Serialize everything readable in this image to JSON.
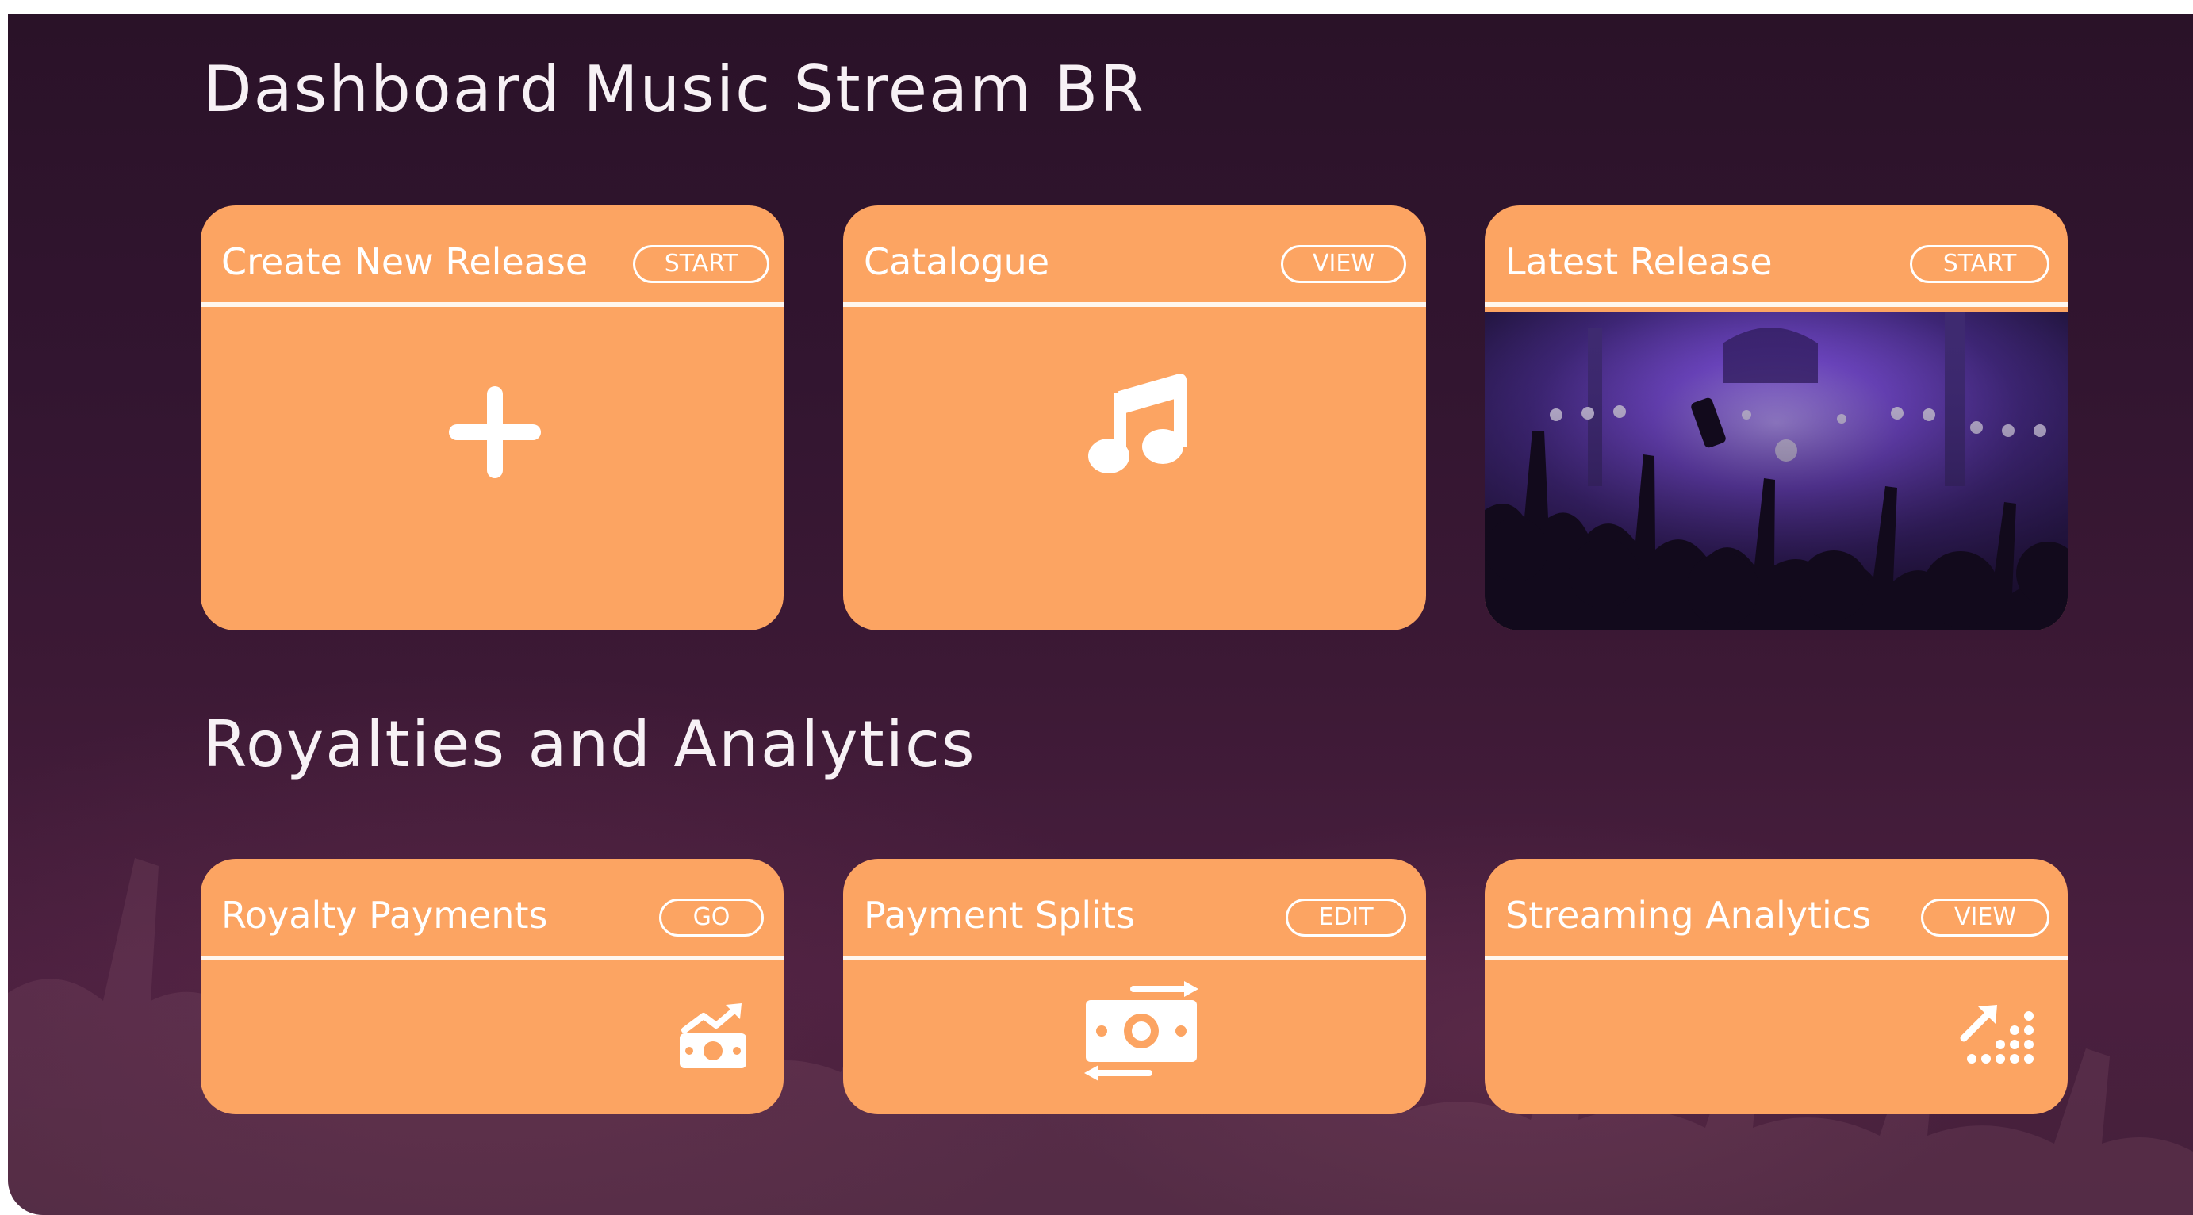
{
  "sections": {
    "dashboard": {
      "title": "Dashboard Music Stream BR",
      "cards": [
        {
          "title": "Create New Release",
          "action": "START",
          "icon": "plus-icon"
        },
        {
          "title": "Catalogue",
          "action": "VIEW",
          "icon": "music-note-icon"
        },
        {
          "title": "Latest Release",
          "action": "START",
          "image": "concert-crowd-image"
        }
      ]
    },
    "royalties": {
      "title": "Royalties and Analytics",
      "cards": [
        {
          "title": "Royalty Payments",
          "action": "GO",
          "icon": "money-growth-icon"
        },
        {
          "title": "Payment Splits",
          "action": "EDIT",
          "icon": "money-exchange-icon"
        },
        {
          "title": "Streaming Analytics",
          "action": "VIEW",
          "icon": "growth-dots-icon"
        }
      ]
    }
  },
  "colors": {
    "card": "#fca462",
    "background": "#3a1733",
    "text": "#ffffff"
  }
}
